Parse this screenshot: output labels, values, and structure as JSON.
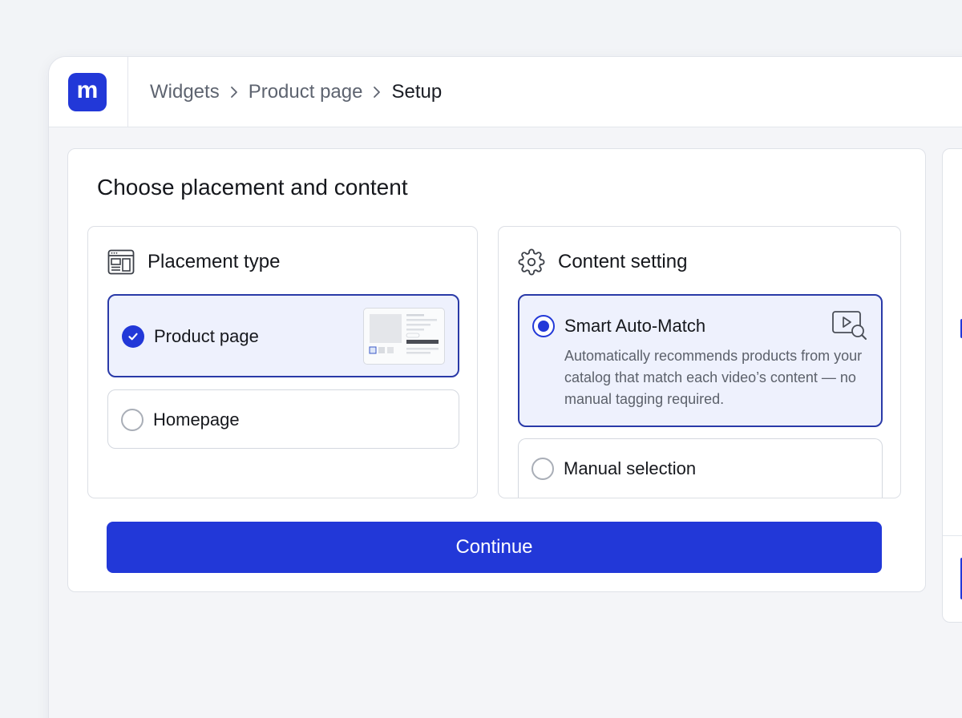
{
  "app": {
    "logo_letter": "m",
    "brand_color": "#2238d8"
  },
  "breadcrumb": {
    "items": [
      "Widgets",
      "Product page"
    ],
    "current": "Setup"
  },
  "main": {
    "title": "Choose placement and content",
    "placement": {
      "heading": "Placement type",
      "icon": "layout-icon",
      "options": [
        {
          "label": "Product page",
          "selected": true
        },
        {
          "label": "Homepage",
          "selected": false
        }
      ]
    },
    "content": {
      "heading": "Content setting",
      "icon": "gear-icon",
      "options": [
        {
          "label": "Smart Auto-Match",
          "description": "Automatically recommends products from your catalog that match each video’s content — no manual tagging required.",
          "selected": true,
          "icon": "video-search-icon"
        },
        {
          "label": "Manual selection",
          "selected": false
        }
      ]
    },
    "continue_label": "Continue"
  }
}
